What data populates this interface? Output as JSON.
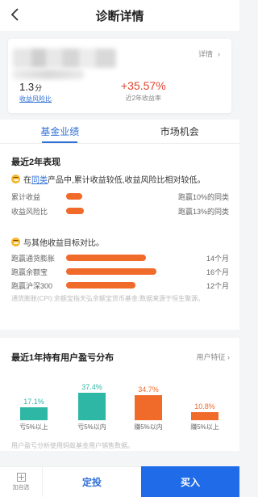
{
  "header": {
    "title": "诊断详情"
  },
  "fund": {
    "detail_label": "详情",
    "metric1_value": "1.3",
    "metric1_unit": "分",
    "metric1_label": "收益风险比",
    "metric2_value": "+35.57%",
    "metric2_label": "近2年收益率"
  },
  "tabs": [
    {
      "label": "基金业绩",
      "active": true
    },
    {
      "label": "市场机会",
      "active": false
    }
  ],
  "performance": {
    "section_title": "最近2年表现",
    "note1_prefix": "在",
    "note1_link": "同类",
    "note1_suffix": "产品中,累计收益较低,收益风险比相对较低。",
    "peer_rows": [
      {
        "label": "累计收益",
        "value": "跑赢10%的同类",
        "fill": 0.1
      },
      {
        "label": "收益风险比",
        "value": "跑赢13%的同类",
        "fill": 0.13
      }
    ],
    "note2": "与其他收益目标对比。",
    "target_rows": [
      {
        "label": "跑赢通货膨胀",
        "value": "14个月",
        "months": 14
      },
      {
        "label": "跑赢余额宝",
        "value": "16个月",
        "months": 16
      },
      {
        "label": "跑赢沪深300",
        "value": "12个月",
        "months": 12
      }
    ],
    "source_note": "通货膨胀(CPI):余额宝指天弘余额宝货币基金;数据来源于恒生聚源。"
  },
  "distribution": {
    "title": "最近1年持有用户盈亏分布",
    "link_label": "用户特征",
    "columns": [
      {
        "pct": "17.1%",
        "label": "亏5%以上",
        "value": 17.1,
        "color": "#2fb7a6"
      },
      {
        "pct": "37.4%",
        "label": "亏5%以内",
        "value": 37.4,
        "color": "#2fb7a6"
      },
      {
        "pct": "34.7%",
        "label": "赚5%以内",
        "value": 34.7,
        "color": "#f06a2a"
      },
      {
        "pct": "10.8%",
        "label": "赚5%以上",
        "value": 10.8,
        "color": "#f06a2a"
      }
    ],
    "footnote": "用户盈亏分析使用蚂蚁基金用户销售数据。"
  },
  "bottom": {
    "fav_label": "加自选",
    "fixed_label": "定投",
    "buy_label": "买入"
  },
  "colors": {
    "accent": "#2f6fd8",
    "up": "#e2452f",
    "bar": "#f06a2a",
    "loss": "#2fb7a6",
    "buy": "#1f6be8"
  }
}
